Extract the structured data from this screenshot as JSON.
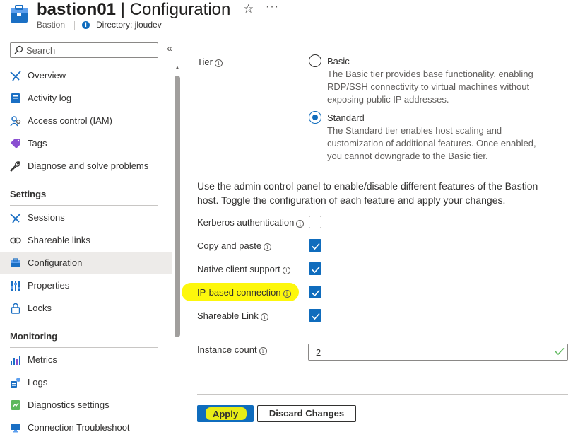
{
  "header": {
    "resource_name": "bastion01",
    "separator": "|",
    "page_title": "Configuration",
    "resource_type": "Bastion",
    "directory_label": "Directory: jloudev",
    "star_icon": "star-icon",
    "more_icon": "ellipsis-icon"
  },
  "sidebar": {
    "search_placeholder": "Search",
    "collapse_glyph": "«",
    "top_items": [
      {
        "label": "Overview",
        "icon": "overview-icon"
      },
      {
        "label": "Activity log",
        "icon": "activity-log-icon"
      },
      {
        "label": "Access control (IAM)",
        "icon": "iam-icon"
      },
      {
        "label": "Tags",
        "icon": "tag-icon"
      },
      {
        "label": "Diagnose and solve problems",
        "icon": "wrench-icon"
      }
    ],
    "settings_heading": "Settings",
    "settings_items": [
      {
        "label": "Sessions",
        "icon": "sessions-icon"
      },
      {
        "label": "Shareable links",
        "icon": "link-icon"
      },
      {
        "label": "Configuration",
        "icon": "configuration-icon",
        "selected": true
      },
      {
        "label": "Properties",
        "icon": "properties-icon"
      },
      {
        "label": "Locks",
        "icon": "lock-icon"
      }
    ],
    "monitoring_heading": "Monitoring",
    "monitoring_items": [
      {
        "label": "Metrics",
        "icon": "metrics-icon"
      },
      {
        "label": "Logs",
        "icon": "logs-icon"
      },
      {
        "label": "Diagnostics settings",
        "icon": "diagnostics-icon"
      },
      {
        "label": "Connection Troubleshoot",
        "icon": "troubleshoot-icon"
      }
    ]
  },
  "main": {
    "tier_label": "Tier",
    "tiers": [
      {
        "name": "Basic",
        "selected": false,
        "description": "The Basic tier provides base functionality, enabling RDP/SSH connectivity to virtual machines without exposing public IP addresses."
      },
      {
        "name": "Standard",
        "selected": true,
        "description": "The Standard tier enables host scaling and customization of additional features. Once enabled, you cannot downgrade to the Basic tier."
      }
    ],
    "admin_text": "Use the admin control panel to enable/disable different features of the Bastion host. Toggle the configuration of each feature and apply your changes.",
    "features": [
      {
        "label": "Kerberos authentication",
        "checked": false
      },
      {
        "label": "Copy and paste",
        "checked": true
      },
      {
        "label": "Native client support",
        "checked": true
      },
      {
        "label": "IP-based connection",
        "checked": true,
        "highlighted": true
      },
      {
        "label": "Shareable Link",
        "checked": true
      }
    ],
    "instance_count_label": "Instance count",
    "instance_count_value": "2",
    "apply_label": "Apply",
    "discard_label": "Discard Changes"
  },
  "colors": {
    "accent": "#0f6cbd",
    "highlight": "#fdf70c",
    "selected_bg": "#edebe9"
  }
}
